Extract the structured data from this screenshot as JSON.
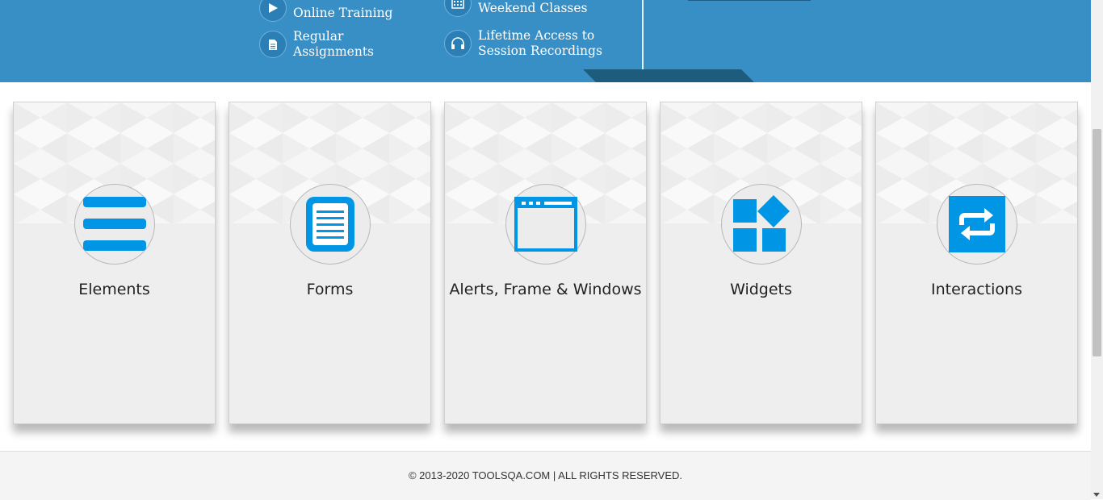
{
  "banner": {
    "features": [
      {
        "text": "Online Training",
        "icon": "play-icon"
      },
      {
        "text": "Weekend Classes",
        "icon": "calendar-icon"
      },
      {
        "text": "Regular\nAssignments",
        "icon": "document-icon"
      },
      {
        "text": "Lifetime Access to\nSession Recordings",
        "icon": "headphones-icon"
      }
    ]
  },
  "cards": [
    {
      "title": "Elements",
      "icon": "menu-lines-icon"
    },
    {
      "title": "Forms",
      "icon": "form-document-icon"
    },
    {
      "title": "Alerts, Frame & Windows",
      "icon": "browser-window-icon"
    },
    {
      "title": "Widgets",
      "icon": "widgets-icon"
    },
    {
      "title": "Interactions",
      "icon": "swap-arrows-icon"
    }
  ],
  "footer": {
    "copyright": "© 2013-2020 TOOLSQA.COM | ALL RIGHTS RESERVED."
  },
  "colors": {
    "banner_blue": "#388fc6",
    "icon_blue": "#0095e5",
    "card_bg": "#eeeeee"
  }
}
